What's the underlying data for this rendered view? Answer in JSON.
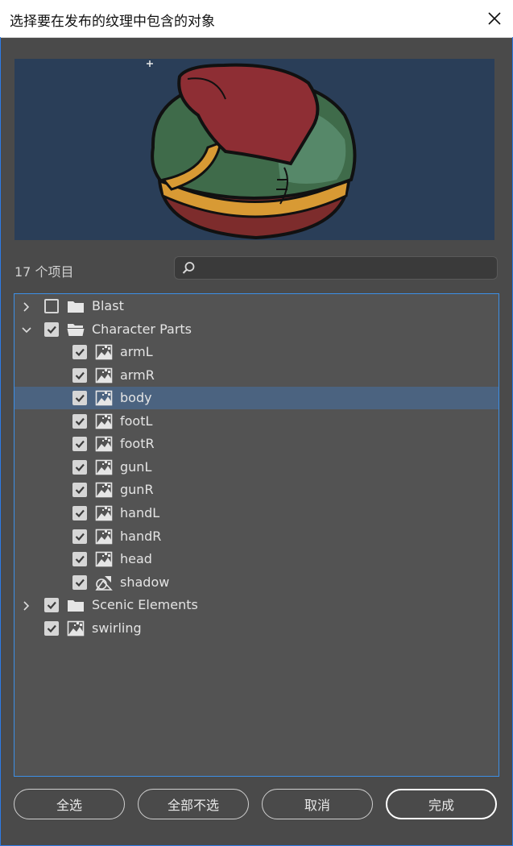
{
  "dialog": {
    "title": "选择要在发布的纹理中包含的对象",
    "item_count": "17 个项目"
  },
  "search": {
    "value": "",
    "placeholder": ""
  },
  "tree": [
    {
      "label": "Blast",
      "depth": 0,
      "kind": "folder",
      "expandable": true,
      "expanded": false,
      "checked": false,
      "selected": false
    },
    {
      "label": "Character Parts",
      "depth": 0,
      "kind": "folder",
      "expandable": true,
      "expanded": true,
      "checked": true,
      "selected": false
    },
    {
      "label": "armL",
      "depth": 1,
      "kind": "bitmap",
      "checked": true,
      "selected": false
    },
    {
      "label": "armR",
      "depth": 1,
      "kind": "bitmap",
      "checked": true,
      "selected": false
    },
    {
      "label": "body",
      "depth": 1,
      "kind": "bitmap",
      "checked": true,
      "selected": true
    },
    {
      "label": "footL",
      "depth": 1,
      "kind": "bitmap",
      "checked": true,
      "selected": false
    },
    {
      "label": "footR",
      "depth": 1,
      "kind": "bitmap",
      "checked": true,
      "selected": false
    },
    {
      "label": "gunL",
      "depth": 1,
      "kind": "bitmap",
      "checked": true,
      "selected": false
    },
    {
      "label": "gunR",
      "depth": 1,
      "kind": "bitmap",
      "checked": true,
      "selected": false
    },
    {
      "label": "handL",
      "depth": 1,
      "kind": "bitmap",
      "checked": true,
      "selected": false
    },
    {
      "label": "handR",
      "depth": 1,
      "kind": "bitmap",
      "checked": true,
      "selected": false
    },
    {
      "label": "head",
      "depth": 1,
      "kind": "bitmap",
      "checked": true,
      "selected": false
    },
    {
      "label": "shadow",
      "depth": 1,
      "kind": "graphic",
      "checked": true,
      "selected": false
    },
    {
      "label": "Scenic Elements",
      "depth": 0,
      "kind": "folder",
      "expandable": true,
      "expanded": false,
      "checked": true,
      "selected": false
    },
    {
      "label": "swirling",
      "depth": 0,
      "kind": "bitmap",
      "checked": true,
      "selected": false
    }
  ],
  "buttons": {
    "select_all": "全选",
    "select_none": "全部不选",
    "cancel": "取消",
    "done": "完成"
  },
  "colors": {
    "background": "#4a4a4a",
    "preview_bg": "#2a3e58",
    "tree_bg": "#535353",
    "selection": "#4b6380",
    "accent_border": "#3d8fe6"
  },
  "icons": {
    "close": "close-icon",
    "search": "search-icon",
    "folder": "folder-icon",
    "folder_open": "folder-open-icon",
    "bitmap": "bitmap-icon",
    "graphic": "graphic-symbol-icon",
    "chevron_right": "chevron-right-icon",
    "chevron_down": "chevron-down-icon"
  }
}
